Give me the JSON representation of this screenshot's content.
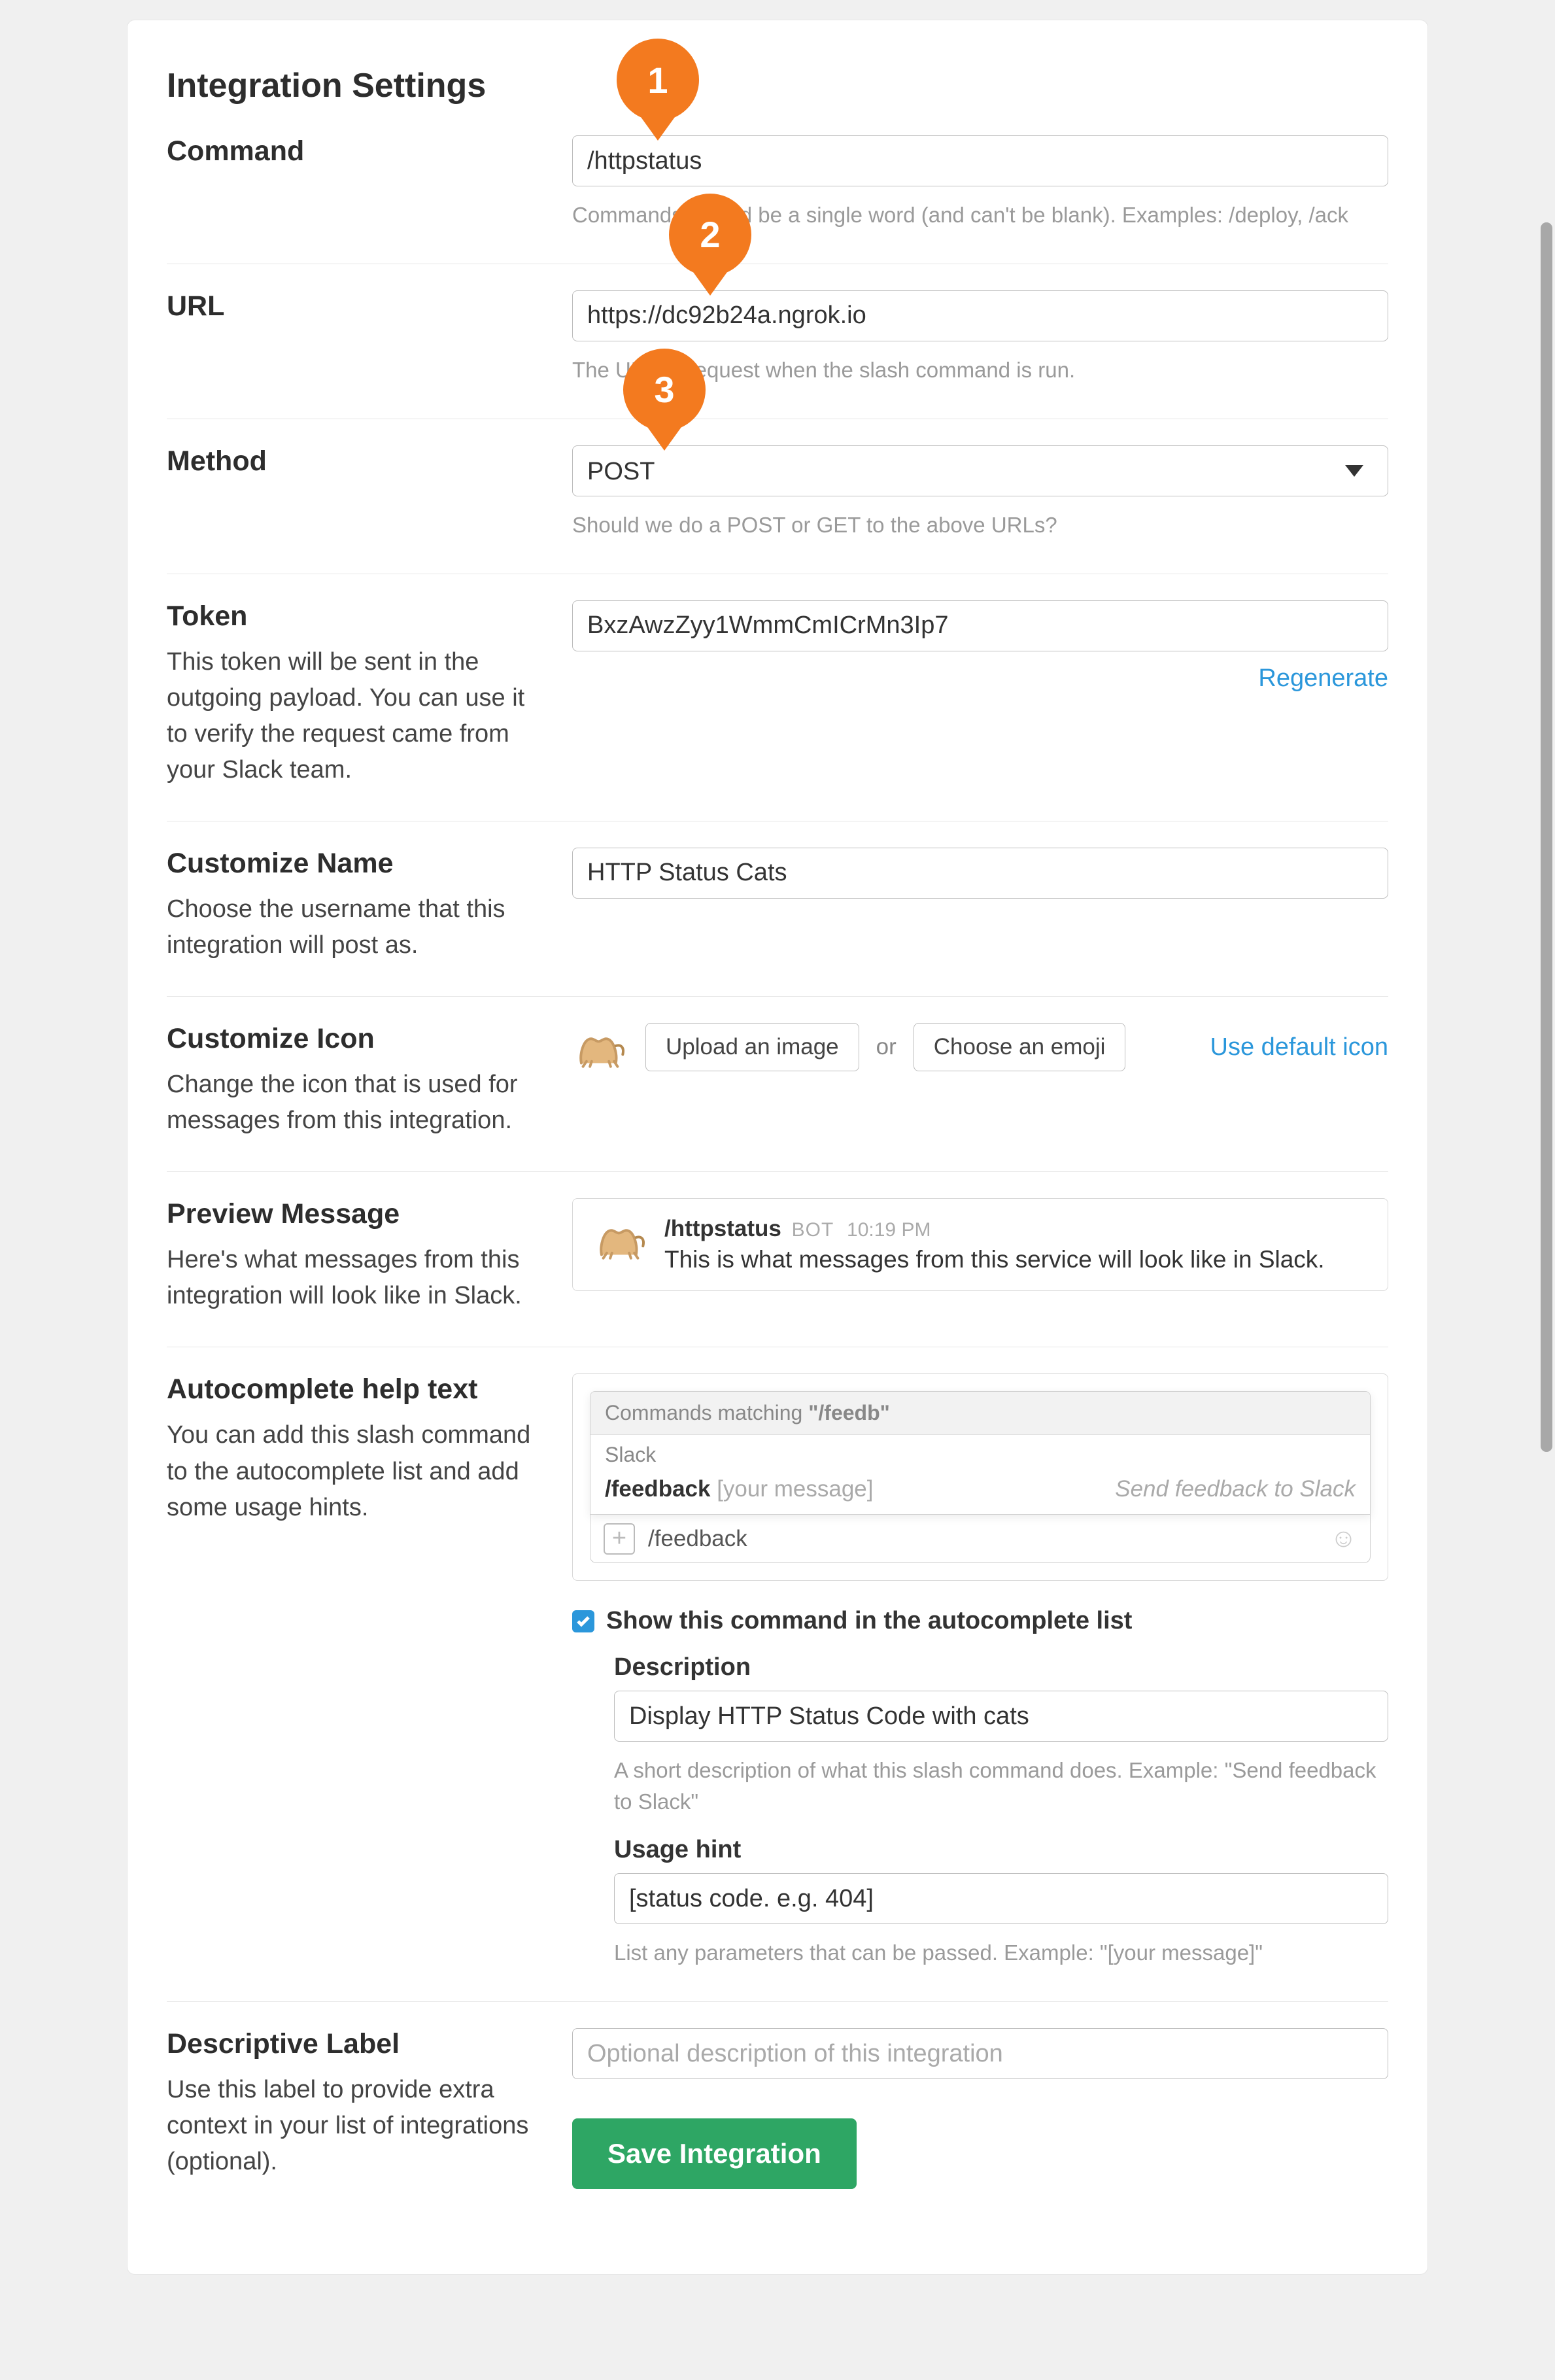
{
  "page_title": "Integration Settings",
  "callouts": {
    "c1": "1",
    "c2": "2",
    "c3": "3"
  },
  "command": {
    "label": "Command",
    "value": "/httpstatus",
    "hint": "Commands should be a single word (and can't be blank). Examples: /deploy, /ack"
  },
  "url": {
    "label": "URL",
    "value": "https://dc92b24a.ngrok.io",
    "hint": "The URL to request when the slash command is run."
  },
  "method": {
    "label": "Method",
    "value": "POST",
    "hint": "Should we do a POST or GET to the above URLs?"
  },
  "token": {
    "label": "Token",
    "desc": "This token will be sent in the outgoing payload. You can use it to verify the request came from your Slack team.",
    "value": "BxzAwzZyy1WmmCmICrMn3Ip7",
    "regenerate": "Regenerate"
  },
  "custom_name": {
    "label": "Customize Name",
    "desc": "Choose the username that this integration will post as.",
    "value": "HTTP Status Cats"
  },
  "custom_icon": {
    "label": "Customize Icon",
    "desc": "Change the icon that is used for messages from this integration.",
    "upload": "Upload an image",
    "or": "or",
    "emoji": "Choose an emoji",
    "default": "Use default icon"
  },
  "preview": {
    "label": "Preview Message",
    "desc": "Here's what messages from this integration will look like in Slack.",
    "bot_name": "/httpstatus",
    "bot_tag": "BOT",
    "time": "10:19 PM",
    "message": "This is what messages from this service will look like in Slack."
  },
  "autocomplete": {
    "label": "Autocomplete help text",
    "desc": "You can add this slash command to the autocomplete list and add some usage hints.",
    "matching_prefix": "Commands matching ",
    "matching_query": "\"/feedb\"",
    "section": "Slack",
    "item_cmd": "/feedback",
    "item_hint": " [your message]",
    "item_desc": "Send feedback to Slack",
    "input_value": "/feedback",
    "checkbox_checked": true,
    "checkbox_label": "Show this command in the autocomplete list",
    "description_label": "Description",
    "description_value": "Display HTTP Status Code with cats",
    "description_hint": "A short description of what this slash command does. Example: \"Send feedback to Slack\"",
    "usage_label": "Usage hint",
    "usage_value": "[status code. e.g. 404]",
    "usage_hint": "List any parameters that can be passed. Example: \"[your message]\""
  },
  "descriptive": {
    "label": "Descriptive Label",
    "desc": "Use this label to provide extra context in your list of integrations (optional).",
    "placeholder": "Optional description of this integration"
  },
  "save": "Save Integration"
}
